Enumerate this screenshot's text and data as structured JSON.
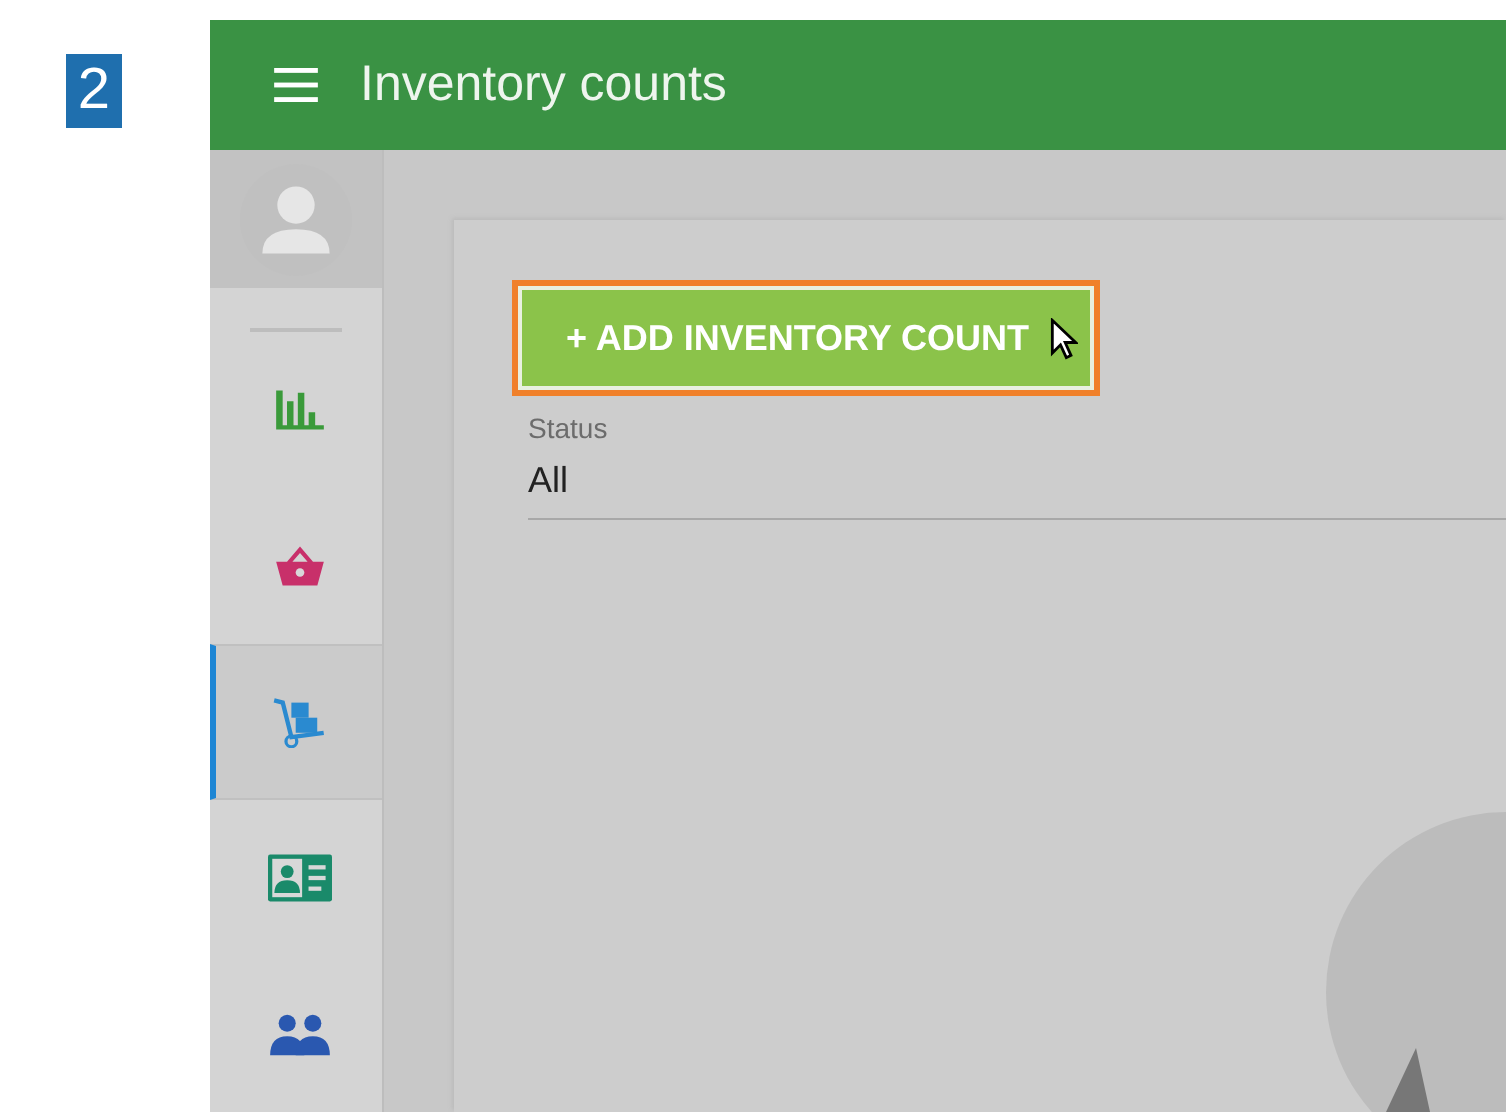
{
  "step_badge": "2",
  "header": {
    "title": "Inventory counts"
  },
  "sidebar": {
    "items": [
      {
        "color": "#3a9a3a",
        "selected": false
      },
      {
        "color": "#c8306a",
        "selected": false
      },
      {
        "color": "#2a8ad0",
        "selected": true
      },
      {
        "color": "#1a8a6a",
        "selected": false
      },
      {
        "color": "#2a58b0",
        "selected": false
      }
    ]
  },
  "add_button": {
    "label": "+ ADD INVENTORY COUNT",
    "highlighted": true
  },
  "status_filter": {
    "label": "Status",
    "value": "All"
  }
}
